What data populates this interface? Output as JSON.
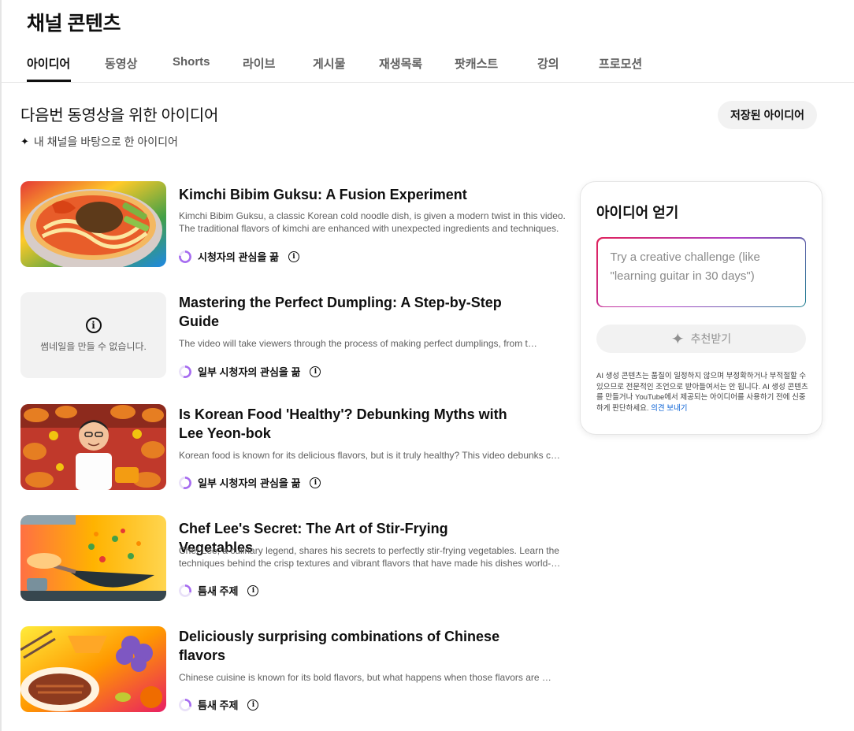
{
  "page": {
    "title": "채널 콘텐츠"
  },
  "tabs": [
    "아이디어",
    "동영상",
    "Shorts",
    "라이브",
    "게시물",
    "재생목록",
    "팟캐스트",
    "강의",
    "프로모션"
  ],
  "section": {
    "title": "다음번 동영상을 위한 아이디어",
    "subtitle": "내 채널을 바탕으로 한 아이디어",
    "saved_button": "저장된 아이디어"
  },
  "ideas": [
    {
      "title": "Kimchi Bibim Guksu: A Fusion Experiment",
      "description": "Kimchi Bibim Guksu, a classic Korean cold noodle dish, is given a modern twist in this video. The traditional flavors of kimchi are enhanced with unexpected ingredients and techniques.",
      "interest": "시청자의 관심을 끎",
      "thumbnail_icon": "noodle-bowl-thumbnail"
    },
    {
      "title": "Mastering the Perfect Dumpling: A Step-by-Step Guide",
      "description": "The video will take viewers through the process of making perfect dumplings, from the dough to the filling.",
      "interest": "일부 시청자의 관심을 끎",
      "thumbnail_empty": "썸네일을 만들 수 없습니다."
    },
    {
      "title": "Is Korean Food 'Healthy'? Debunking Myths with Lee Yeon-bok",
      "description": "Korean food is known for its delicious flavors, but is it truly healthy? This video debunks common myths.",
      "interest": "일부 시청자의 관심을 끎",
      "thumbnail_icon": "chef-banquet-thumbnail"
    },
    {
      "title": "Chef Lee's Secret: The Art of Stir-Frying Vegetables",
      "description": "Chef Lee, a culinary legend, shares his secrets to perfectly stir-frying vegetables. Learn the techniques behind the crisp textures and vibrant flavors that have made his dishes world-famous.",
      "interest": "틈새 주제",
      "thumbnail_icon": "wok-stir-fry-thumbnail"
    },
    {
      "title": "Deliciously surprising combinations of Chinese flavors",
      "description": "Chinese cuisine is known for its bold flavors, but what happens when those flavors are combined in surprising ways?",
      "interest": "틈새 주제",
      "thumbnail_icon": "mango-duck-thumbnail"
    }
  ],
  "panel": {
    "title": "아이디어 얻기",
    "input_placeholder": "Try a creative challenge (like \"learning guitar in 30 days\")",
    "generate_button": "추천받기",
    "disclaimer": "AI 생성 콘텐츠는 품질이 일정하지 않으며 부정확하거나 부적절할 수 있으므로 전문적인 조언으로 받아들여서는 안 됩니다. AI 생성 콘텐츠를 만들거나 YouTube에서 제공되는 아이디어를 사용하기 전에 신중하게 판단하세요.",
    "feedback_link": "의견 보내기"
  },
  "colors": {
    "accent_link": "#065fd4",
    "interest_ring": "#a66cf0"
  }
}
